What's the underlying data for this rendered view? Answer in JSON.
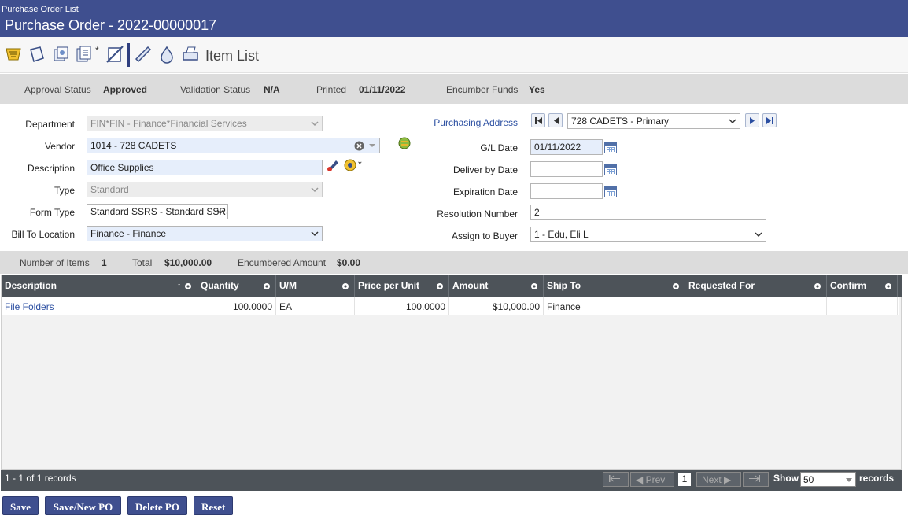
{
  "header": {
    "breadcrumb": "Purchase Order List",
    "title": "Purchase Order - 2022-00000017"
  },
  "toolbar": {
    "label": "Item List",
    "star": "*"
  },
  "status": {
    "approval_label": "Approval Status",
    "approval_value": "Approved",
    "validation_label": "Validation Status",
    "validation_value": "N/A",
    "printed_label": "Printed",
    "printed_value": "01/11/2022",
    "encumber_label": "Encumber Funds",
    "encumber_value": "Yes"
  },
  "form": {
    "department_label": "Department",
    "department_value": "FIN*FIN - Finance*Financial Services",
    "vendor_label": "Vendor",
    "vendor_value": "1014 - 728 CADETS",
    "description_label": "Description",
    "description_value": "Office Supplies",
    "description_star": "*",
    "type_label": "Type",
    "type_value": "Standard",
    "formtype_label": "Form Type",
    "formtype_value": "Standard SSRS - Standard SSRS",
    "billto_label": "Bill To Location",
    "billto_value": "Finance - Finance",
    "purchasing_address_label": "Purchasing Address",
    "purchasing_address_value": "728 CADETS - Primary",
    "gl_date_label": "G/L Date",
    "gl_date_value": "01/11/2022",
    "deliver_label": "Deliver by Date",
    "deliver_value": "",
    "expiration_label": "Expiration Date",
    "expiration_value": "",
    "resolution_label": "Resolution Number",
    "resolution_value": "2",
    "buyer_label": "Assign to Buyer",
    "buyer_value": "1 - Edu, Eli L"
  },
  "summary": {
    "items_label": "Number of Items",
    "items_value": "1",
    "total_label": "Total",
    "total_value": "$10,000.00",
    "encumbered_label": "Encumbered Amount",
    "encumbered_value": "$0.00"
  },
  "grid": {
    "columns": [
      "Description",
      "Quantity",
      "U/M",
      "Price per Unit",
      "Amount",
      "Ship To",
      "Requested For",
      "Confirm"
    ],
    "sort_indicator": "↑",
    "rows": [
      {
        "description": "File Folders",
        "quantity": "100.0000",
        "um": "EA",
        "price": "100.0000",
        "amount": "$10,000.00",
        "ship_to": "Finance",
        "requested_for": "",
        "confirm": ""
      }
    ]
  },
  "pager": {
    "records_text": "1 - 1 of 1 records",
    "prev_label": "Prev",
    "next_label": "Next",
    "page": "1",
    "show_label": "Show",
    "page_size": "50",
    "records_label": "records"
  },
  "buttons": {
    "save": "Save",
    "save_new": "Save/New PO",
    "delete": "Delete PO",
    "reset": "Reset"
  },
  "colors": {
    "header_bg": "#3f4f8f",
    "grid_header_bg": "#4d5359",
    "link": "#2a4ea1"
  }
}
